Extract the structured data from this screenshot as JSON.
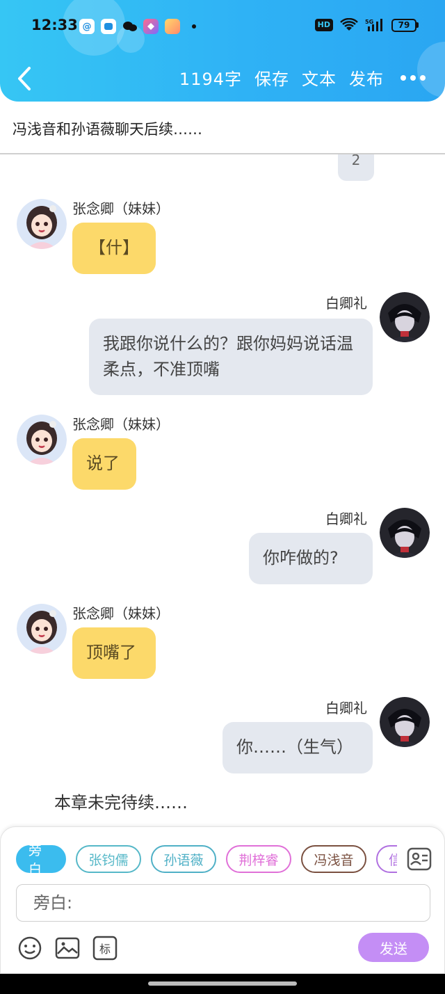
{
  "status_bar": {
    "time": "12:33",
    "battery": "79",
    "hd": "HD",
    "signal": "5G"
  },
  "toolbar": {
    "word_count": "1194字",
    "save_label": "保存",
    "text_label": "文本",
    "publish_label": "发布"
  },
  "chapter_title": "冯浅音和孙语薇聊天后续……",
  "partial_bubble_text": "2",
  "messages": [
    {
      "speaker": "张念卿（妹妹）",
      "text": "【什】",
      "side": "left"
    },
    {
      "speaker": "白卿礼",
      "text": "我跟你说什么的？跟你妈妈说话温柔点，不准顶嘴",
      "side": "right"
    },
    {
      "speaker": "张念卿（妹妹）",
      "text": "说了",
      "side": "left"
    },
    {
      "speaker": "白卿礼",
      "text": "你咋做的?",
      "side": "right"
    },
    {
      "speaker": "张念卿（妹妹）",
      "text": "顶嘴了",
      "side": "left"
    },
    {
      "speaker": "白卿礼",
      "text": "你……（生气）",
      "side": "right"
    }
  ],
  "end_note": "本章未完待续……",
  "characters": [
    {
      "label": "旁白",
      "color": "#3bbcee"
    },
    {
      "label": "张钧儒",
      "color": "#56b8c8"
    },
    {
      "label": "孙语薇",
      "color": "#4fb0c6"
    },
    {
      "label": "荆梓睿",
      "color": "#e070d8"
    },
    {
      "label": "冯浅音",
      "color": "#7a5040"
    },
    {
      "label": "信",
      "color": "#b070e0"
    }
  ],
  "input": {
    "placeholder": "旁白:"
  },
  "tools": {
    "mark_label": "标"
  },
  "send_label": "发送"
}
